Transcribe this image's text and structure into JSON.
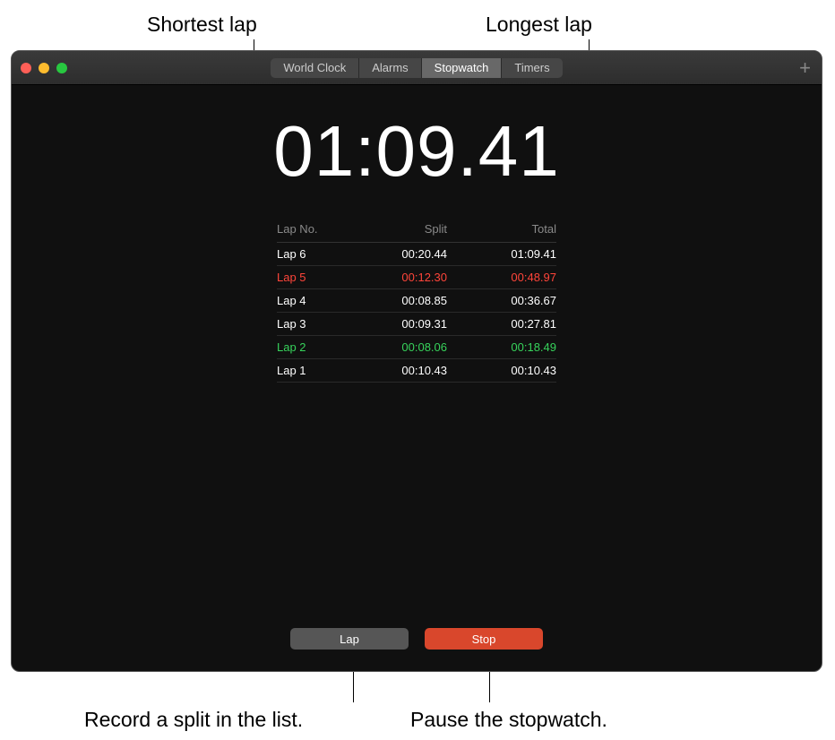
{
  "annotations": {
    "shortest": "Shortest lap",
    "longest": "Longest lap",
    "record": "Record a split in the list.",
    "pause": "Pause the stopwatch."
  },
  "window": {
    "add_icon": "+"
  },
  "tabs": {
    "items": [
      {
        "label": "World Clock"
      },
      {
        "label": "Alarms"
      },
      {
        "label": "Stopwatch"
      },
      {
        "label": "Timers"
      }
    ],
    "active_index": 2
  },
  "stopwatch": {
    "time": "01:09.41"
  },
  "lap_table": {
    "headers": {
      "lap": "Lap No.",
      "split": "Split",
      "total": "Total"
    },
    "rows": [
      {
        "lap": "Lap 6",
        "split": "00:20.44",
        "total": "01:09.41",
        "type": "normal"
      },
      {
        "lap": "Lap 5",
        "split": "00:12.30",
        "total": "00:48.97",
        "type": "longest"
      },
      {
        "lap": "Lap 4",
        "split": "00:08.85",
        "total": "00:36.67",
        "type": "normal"
      },
      {
        "lap": "Lap 3",
        "split": "00:09.31",
        "total": "00:27.81",
        "type": "normal"
      },
      {
        "lap": "Lap 2",
        "split": "00:08.06",
        "total": "00:18.49",
        "type": "shortest"
      },
      {
        "lap": "Lap 1",
        "split": "00:10.43",
        "total": "00:10.43",
        "type": "normal"
      }
    ]
  },
  "buttons": {
    "lap": "Lap",
    "stop": "Stop"
  }
}
